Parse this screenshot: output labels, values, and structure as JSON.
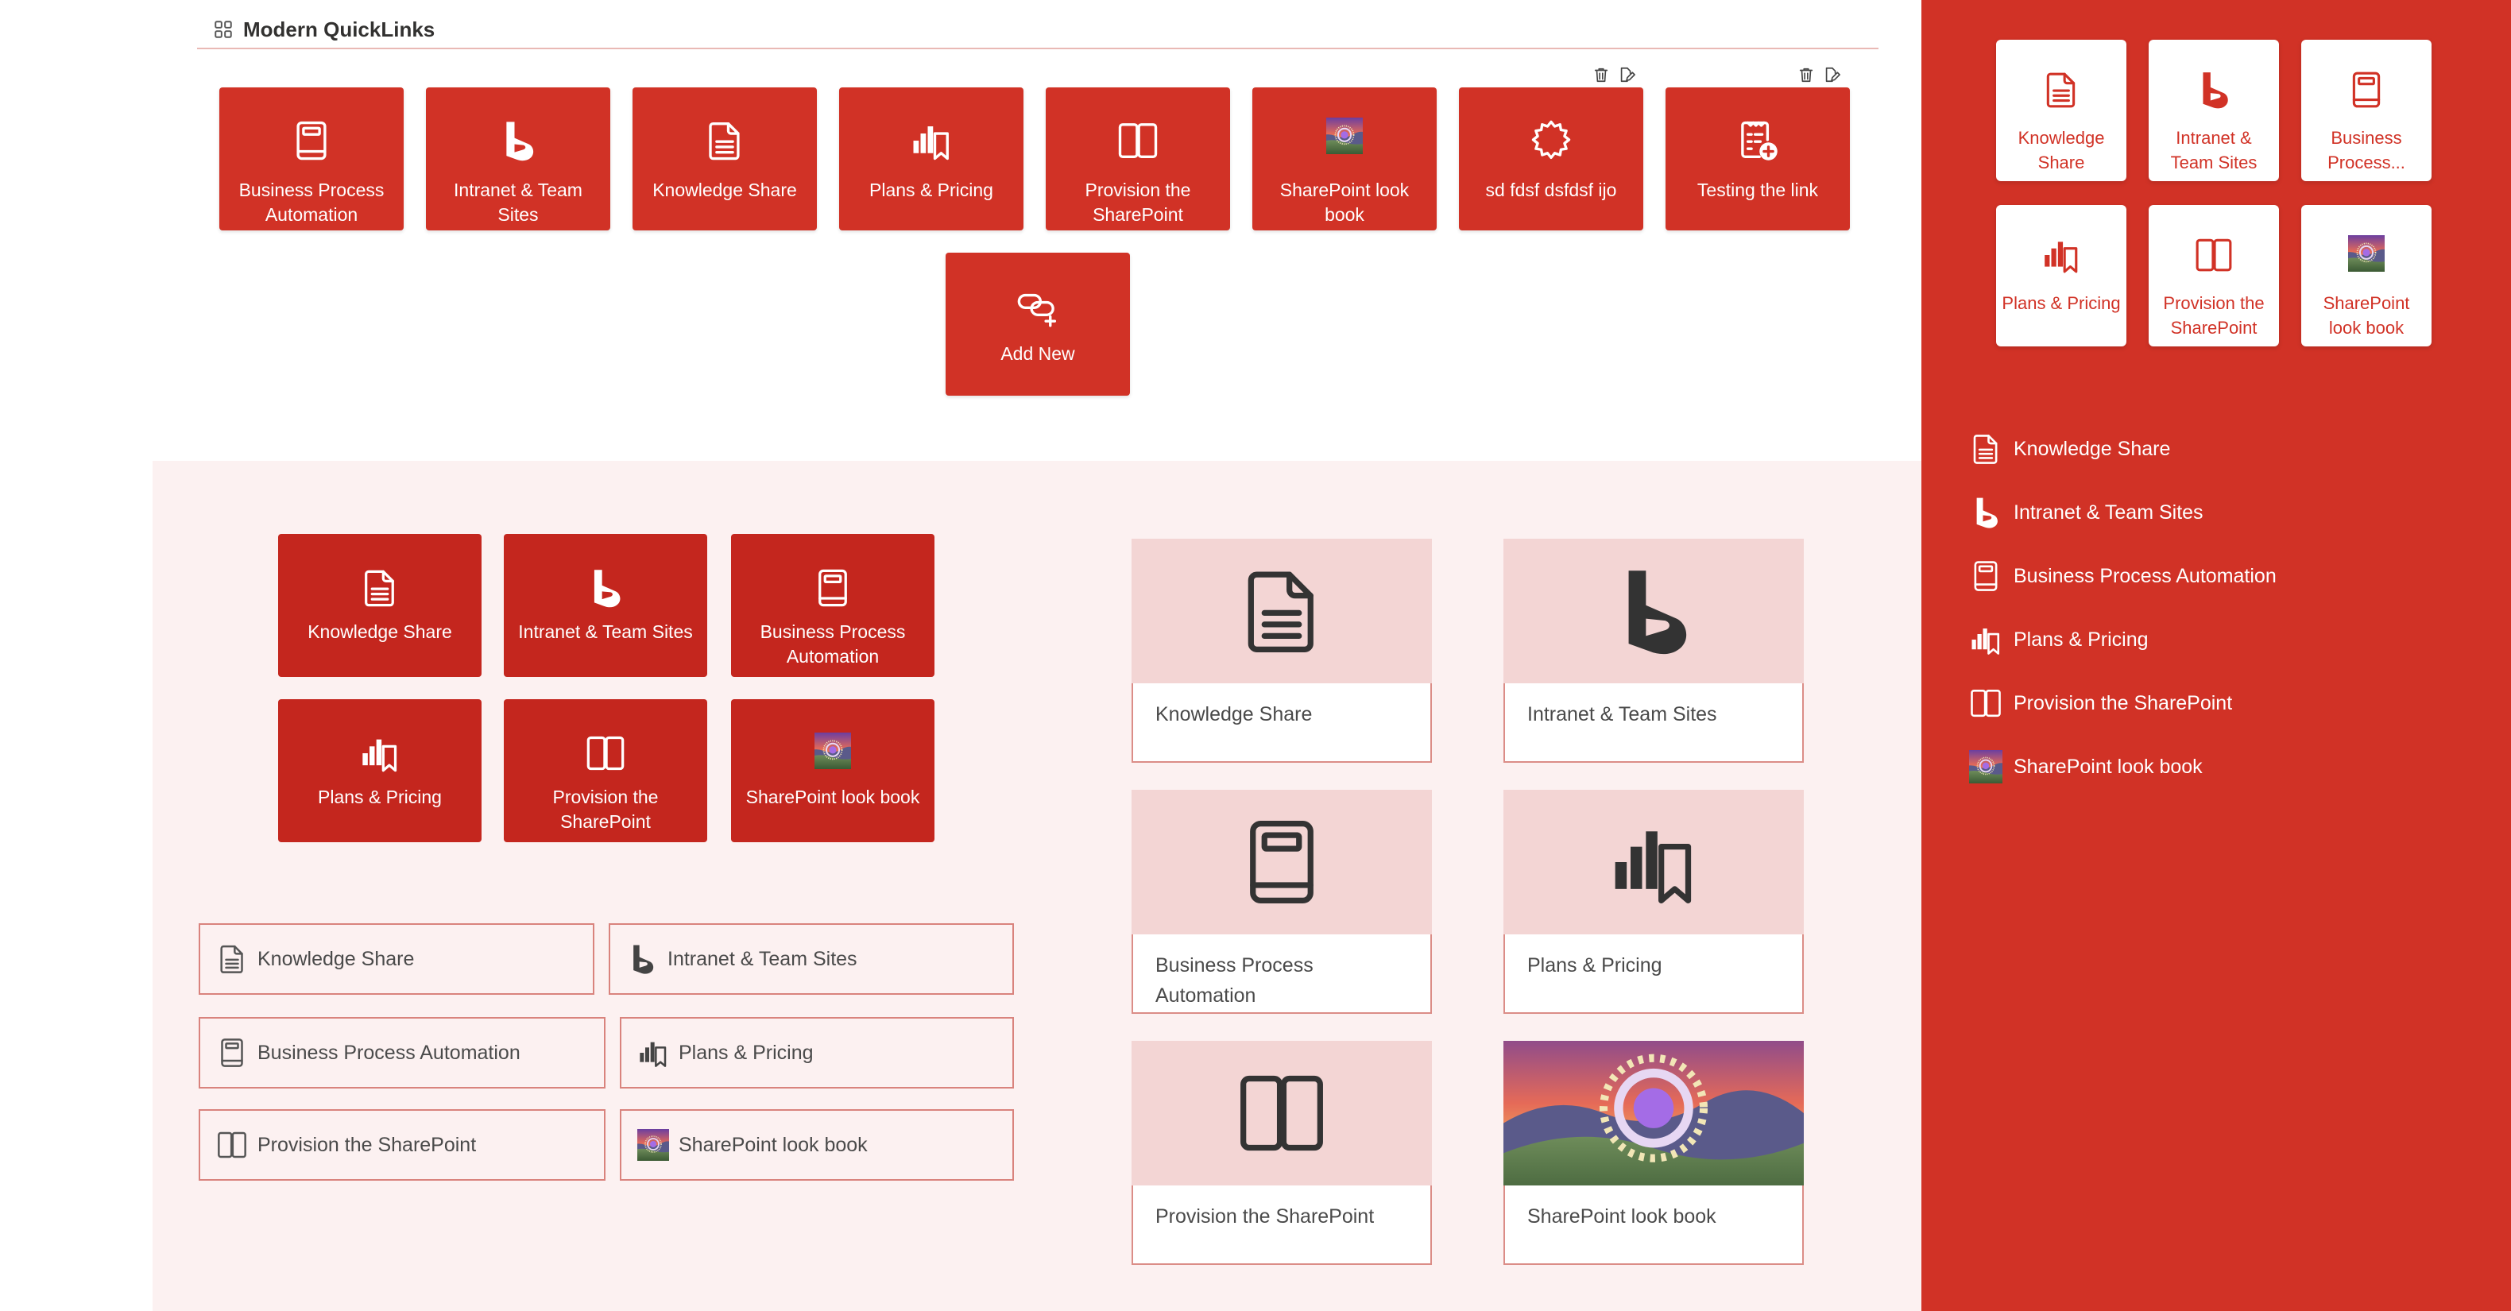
{
  "header": {
    "title": "Modern QuickLinks",
    "icon": "grid-icon"
  },
  "colors": {
    "brand_red": "#d13226",
    "tile_red": "#c4261e",
    "pink_bg": "#fcf1f1",
    "card_top": "#f3d5d4",
    "border_pink": "#d9837d"
  },
  "top_tiles": [
    {
      "label": "Business Process Automation",
      "icon": "book-icon"
    },
    {
      "label": "Intranet & Team Sites",
      "icon": "bing-icon"
    },
    {
      "label": "Knowledge Share",
      "icon": "document-icon"
    },
    {
      "label": "Plans & Pricing",
      "icon": "chart-bookmark-icon"
    },
    {
      "label": "Provision the SharePoint",
      "icon": "open-book-icon"
    },
    {
      "label": "SharePoint look book",
      "icon": "landscape-image-icon"
    },
    {
      "label": "sd fdsf dsfdsf ijo",
      "icon": "badge-icon"
    },
    {
      "label": "Testing the link",
      "icon": "clipboard-add-icon"
    },
    {
      "label": "Add New",
      "icon": "link-add-icon"
    }
  ],
  "red_tiles": [
    {
      "label": "Knowledge Share",
      "icon": "document-icon"
    },
    {
      "label": "Intranet & Team Sites",
      "icon": "bing-icon"
    },
    {
      "label": "Business Process Automation",
      "icon": "book-icon"
    },
    {
      "label": "Plans & Pricing",
      "icon": "chart-bookmark-icon"
    },
    {
      "label": "Provision the SharePoint",
      "icon": "open-book-icon"
    },
    {
      "label": "SharePoint look book",
      "icon": "landscape-image-icon"
    }
  ],
  "buttons": [
    {
      "label": "Knowledge Share",
      "icon": "document-icon"
    },
    {
      "label": "Intranet & Team Sites",
      "icon": "bing-icon"
    },
    {
      "label": "Business Process Automation",
      "icon": "book-icon"
    },
    {
      "label": "Plans & Pricing",
      "icon": "chart-bookmark-icon"
    },
    {
      "label": "Provision the SharePoint",
      "icon": "open-book-icon"
    },
    {
      "label": "SharePoint look book",
      "icon": "landscape-image-icon"
    }
  ],
  "cards": [
    {
      "label": "Knowledge Share",
      "icon": "document-icon"
    },
    {
      "label": "Intranet & Team Sites",
      "icon": "bing-icon"
    },
    {
      "label": "Business Process Automation",
      "icon": "book-icon"
    },
    {
      "label": "Plans & Pricing",
      "icon": "chart-bookmark-icon"
    },
    {
      "label": "Provision the SharePoint",
      "icon": "open-book-icon"
    },
    {
      "label": "SharePoint look book",
      "icon": "landscape-image-icon"
    }
  ],
  "panel_tiles": [
    {
      "label": "Knowledge Share",
      "icon": "document-icon"
    },
    {
      "label": "Intranet & Team Sites",
      "icon": "bing-icon"
    },
    {
      "label": "Business Process...",
      "icon": "book-icon"
    },
    {
      "label": "Plans & Pricing",
      "icon": "chart-bookmark-icon"
    },
    {
      "label": "Provision the SharePoint",
      "icon": "open-book-icon"
    },
    {
      "label": "SharePoint look book",
      "icon": "landscape-image-icon"
    }
  ],
  "panel_links": [
    {
      "label": "Knowledge Share",
      "icon": "document-icon"
    },
    {
      "label": "Intranet & Team Sites",
      "icon": "bing-icon"
    },
    {
      "label": "Business Process Automation",
      "icon": "book-icon"
    },
    {
      "label": "Plans & Pricing",
      "icon": "chart-bookmark-icon"
    },
    {
      "label": "Provision the SharePoint",
      "icon": "open-book-icon"
    },
    {
      "label": "SharePoint look book",
      "icon": "landscape-image-icon"
    }
  ]
}
